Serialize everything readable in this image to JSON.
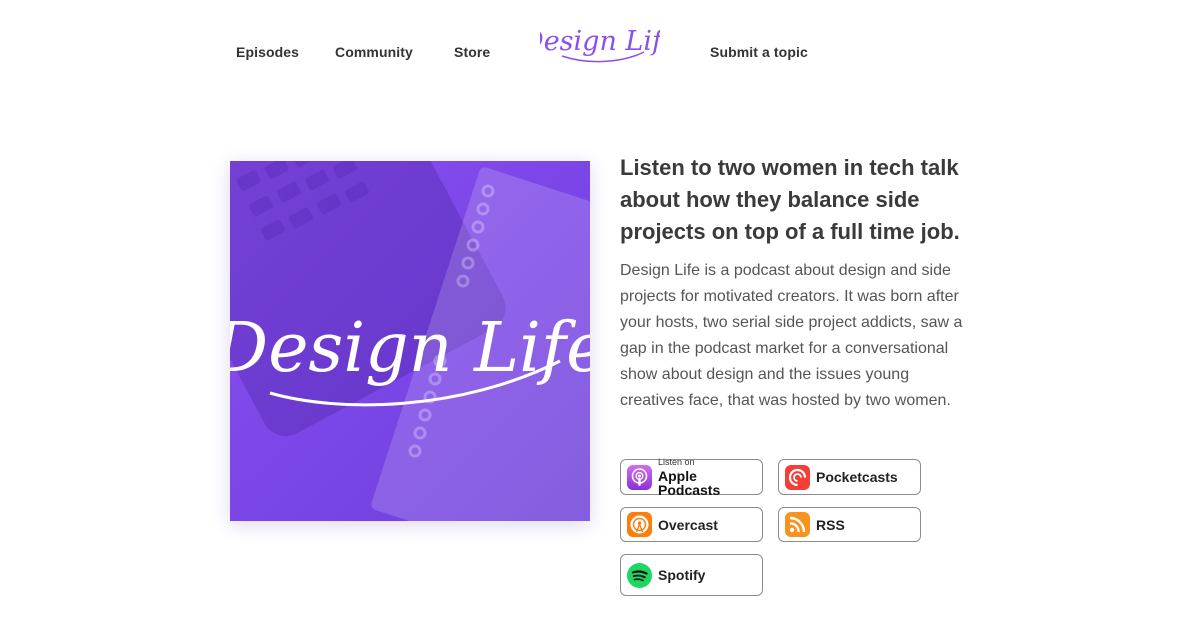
{
  "nav": {
    "items": [
      "Episodes",
      "Community",
      "Store",
      "Submit a topic"
    ],
    "logo_text": "Design Life"
  },
  "cover": {
    "title": "Design Life"
  },
  "hero": {
    "headline": "Listen to two women in tech talk about how they balance side projects on top of a full time job.",
    "description": "Design Life is a podcast about design and side projects for motivated creators. It was born after your hosts, two serial side project addicts, saw a gap in the podcast market for a conversational show about design and the issues young creatives face, that was hosted by two women."
  },
  "badges": {
    "apple_small": "Listen on",
    "apple_big": "Apple Podcasts",
    "pocketcasts": "Pocketcasts",
    "overcast": "Overcast",
    "rss": "RSS",
    "spotify": "Spotify"
  },
  "icons": {
    "apple": "apple-podcasts-icon",
    "pocketcasts": "pocketcasts-icon",
    "overcast": "overcast-icon",
    "rss": "rss-icon",
    "spotify": "spotify-icon"
  },
  "colors": {
    "brand_purple": "#8a4ff0",
    "apple": "#b150e2",
    "pocketcasts": "#f43e37",
    "overcast": "#fc7e0f",
    "rss": "#f7931e",
    "spotify": "#1ed760"
  }
}
